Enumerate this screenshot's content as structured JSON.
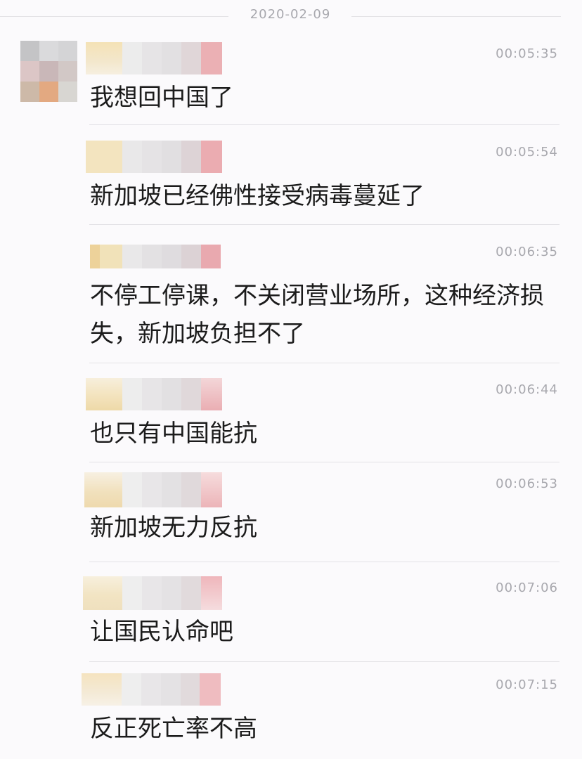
{
  "date_separator": "2020-02-09",
  "messages": [
    {
      "time": "00:05:35",
      "text": "我想回中国了"
    },
    {
      "time": "00:05:54",
      "text": "新加坡已经佛性接受病毒蔓延了"
    },
    {
      "time": "00:06:35",
      "text": "不停工停课，不关闭营业场所，这种经济损失，新加坡负担不了"
    },
    {
      "time": "00:06:44",
      "text": "也只有中国能抗"
    },
    {
      "time": "00:06:53",
      "text": "新加坡无力反抗"
    },
    {
      "time": "00:07:06",
      "text": "让国民认命吧"
    },
    {
      "time": "00:07:15",
      "text": "反正死亡率不高"
    }
  ],
  "colors": {
    "background": "#fbfafc",
    "meta_text": "#a8a8ae",
    "message_text": "#1b1b1b",
    "divider": "#e3e2e6"
  },
  "icons": {
    "avatar": "pixelated-avatar",
    "sender_name": "pixelated-name"
  }
}
